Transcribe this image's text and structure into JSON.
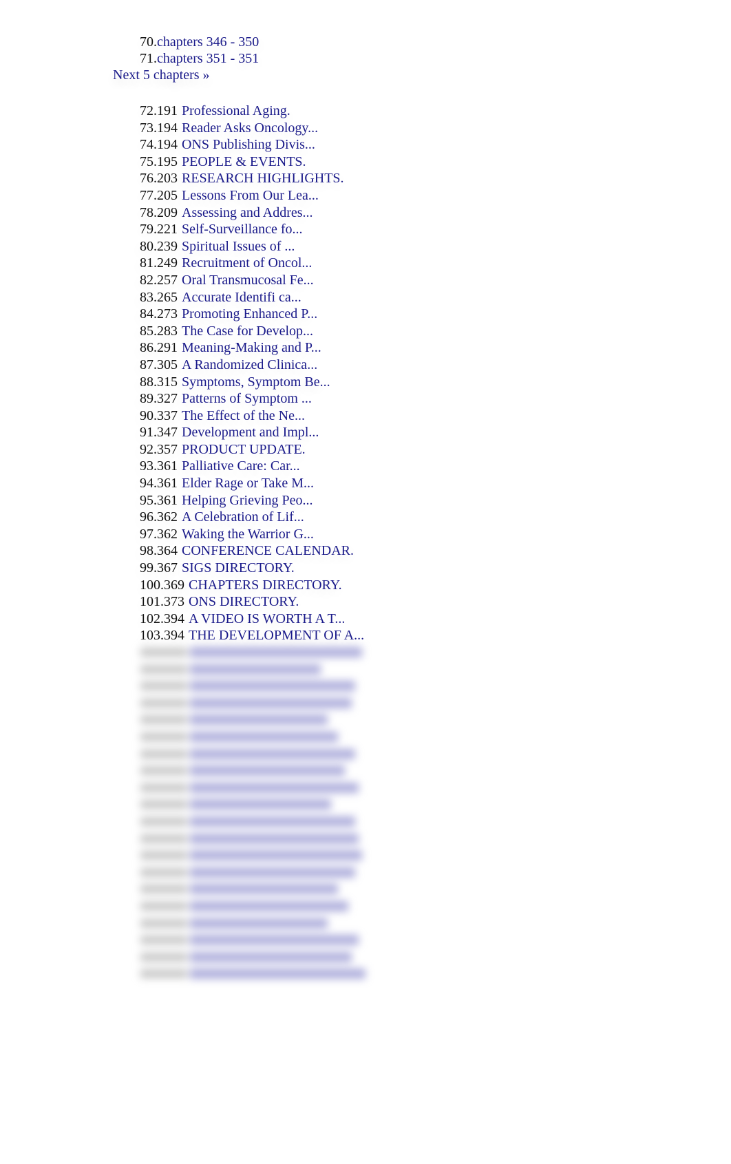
{
  "chapters": [
    {
      "num": "70.",
      "label": "chapters 346 - 350"
    },
    {
      "num": "71.",
      "label": "chapters 351 - 351"
    }
  ],
  "next_link": "Next 5 chapters »",
  "articles": [
    {
      "num": "72.191",
      "title": "Professional Aging."
    },
    {
      "num": "73.194",
      "title": "Reader Asks Oncology..."
    },
    {
      "num": "74.194",
      "title": "ONS Publishing Divis..."
    },
    {
      "num": "75.195",
      "title": "PEOPLE & EVENTS."
    },
    {
      "num": "76.203",
      "title": "RESEARCH HIGHLIGHTS."
    },
    {
      "num": "77.205",
      "title": "Lessons From Our Lea..."
    },
    {
      "num": "78.209",
      "title": "Assessing and Addres..."
    },
    {
      "num": "79.221",
      "title": "Self-Surveillance fo..."
    },
    {
      "num": "80.239",
      "title": "Spiritual Issues of ..."
    },
    {
      "num": "81.249",
      "title": "Recruitment of Oncol..."
    },
    {
      "num": "82.257",
      "title": "Oral Transmucosal Fe..."
    },
    {
      "num": "83.265",
      "title": "Accurate Identifi ca..."
    },
    {
      "num": "84.273",
      "title": "Promoting Enhanced P..."
    },
    {
      "num": "85.283",
      "title": "The Case for Develop..."
    },
    {
      "num": "86.291",
      "title": "Meaning-Making and P..."
    },
    {
      "num": "87.305",
      "title": "A Randomized Clinica..."
    },
    {
      "num": "88.315",
      "title": "Symptoms, Symptom Be..."
    },
    {
      "num": "89.327",
      "title": "Patterns of Symptom ..."
    },
    {
      "num": "90.337",
      "title": "The Effect of the Ne..."
    },
    {
      "num": "91.347",
      "title": "Development and Impl..."
    },
    {
      "num": "92.357",
      "title": "PRODUCT UPDATE."
    },
    {
      "num": "93.361",
      "title": "Palliative Care: Car..."
    },
    {
      "num": "94.361",
      "title": "Elder Rage or Take M..."
    },
    {
      "num": "95.361",
      "title": "Helping Grieving Peo..."
    },
    {
      "num": "96.362",
      "title": "A Celebration of Lif..."
    },
    {
      "num": "97.362",
      "title": "Waking the Warrior G..."
    },
    {
      "num": "98.364",
      "title": "CONFERENCE CALENDAR."
    },
    {
      "num": "99.367",
      "title": "SIGS DIRECTORY."
    },
    {
      "num": "100.369",
      "title": "CHAPTERS DIRECTORY."
    },
    {
      "num": "101.373",
      "title": "ONS DIRECTORY."
    },
    {
      "num": "102.394",
      "title": "A VIDEO IS WORTH A T..."
    },
    {
      "num": "103.394",
      "title": "THE DEVELOPMENT OF A..."
    }
  ],
  "blurred_rows": 20
}
